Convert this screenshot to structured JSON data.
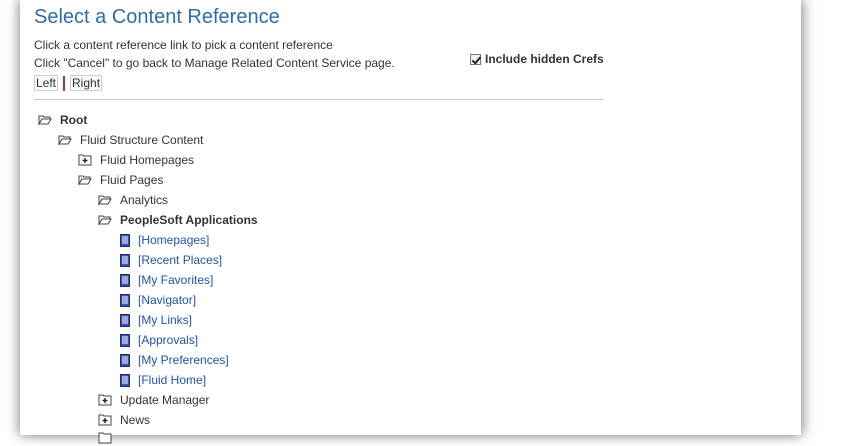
{
  "page": {
    "title": "Select a Content Reference",
    "instruction_1": "Click a content reference link to pick a content reference",
    "instruction_2": "Click \"Cancel\" to go back to Manage Related Content Service page.",
    "include_hidden_label": "Include hidden Crefs",
    "include_hidden_checked": true,
    "left_label": "Left",
    "right_label": "Right"
  },
  "tree": {
    "root": "Root",
    "fluid_structure": "Fluid Structure Content",
    "fluid_homepages": "Fluid Homepages",
    "fluid_pages": "Fluid Pages",
    "analytics": "Analytics",
    "peoplesoft_apps": "PeopleSoft Applications",
    "homepages": "[Homepages]",
    "recent_places": "[Recent Places]",
    "my_favorites": "[My Favorites]",
    "navigator": "[Navigator]",
    "my_links": "[My Links]",
    "approvals": "[Approvals]",
    "my_preferences": "[My Preferences]",
    "fluid_home": "[Fluid Home]",
    "update_manager": "Update Manager",
    "news": "News"
  },
  "colors": {
    "title": "#2e6ea6",
    "link": "#1f55a3",
    "doc_icon": "#3b4fb0"
  },
  "icons": {
    "open": "folder-open-icon",
    "closed": "folder-plus-icon",
    "doc": "document-icon"
  }
}
